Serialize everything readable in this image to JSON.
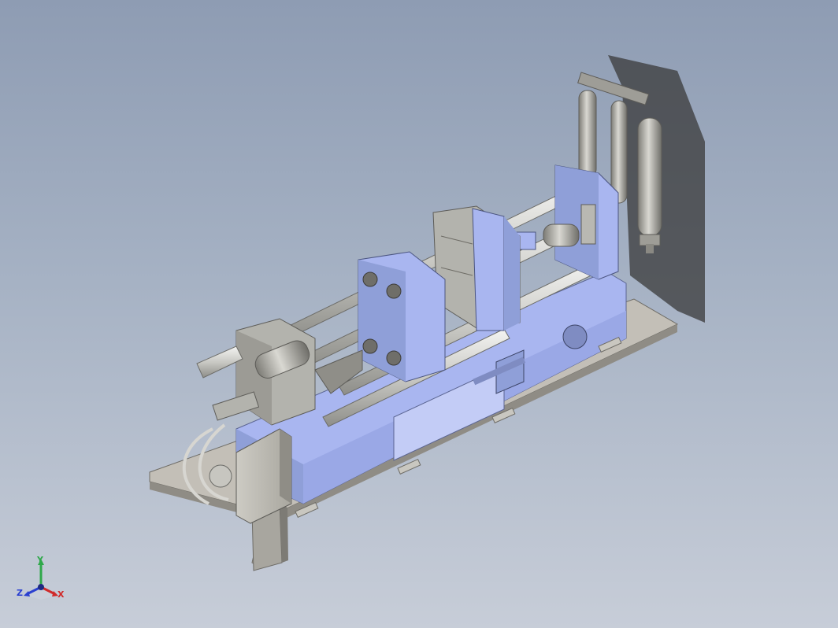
{
  "viewport": {
    "background_top": "#8e9cb3",
    "background_bottom": "#c7cdd8"
  },
  "model": {
    "frame_color": "#a9b6f0",
    "frame_shade": "#8f9fd8",
    "steel_color": "#b3b3ad",
    "steel_shade": "#8f8f8a",
    "base_color": "#c3bfb7"
  },
  "triad": {
    "y_label": "Y",
    "z_label": "Z",
    "x_label": "X",
    "y_color": "#2fa84a",
    "z_color": "#2a3fd0",
    "x_color": "#d02a2a"
  }
}
